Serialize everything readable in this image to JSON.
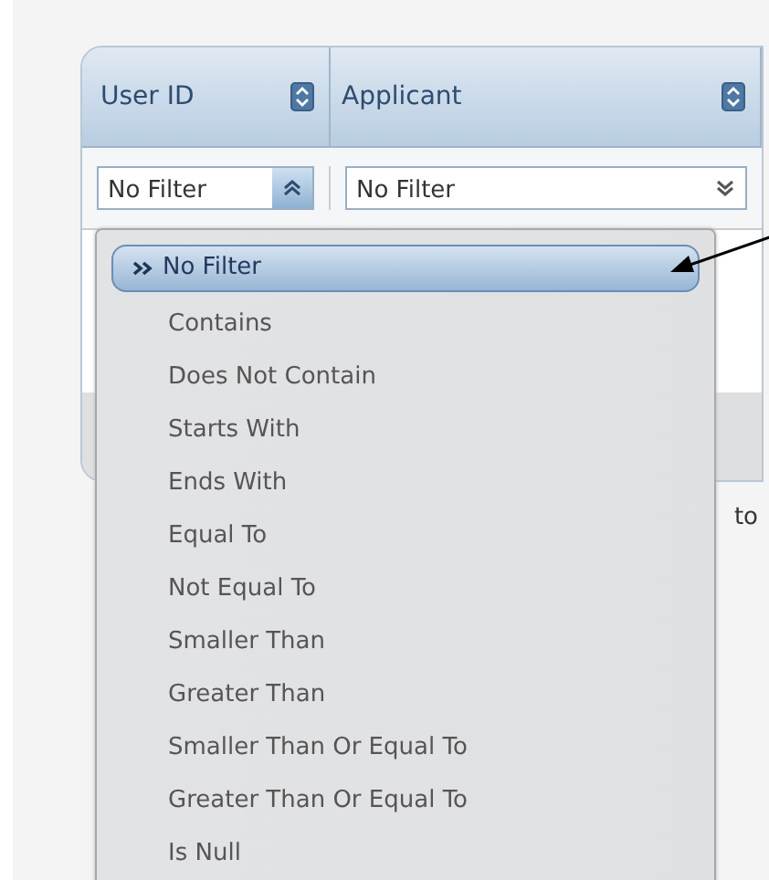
{
  "columns": [
    {
      "title": "User ID",
      "filter": {
        "value": "No Filter",
        "expanded": true
      }
    },
    {
      "title": "Applicant",
      "filter": {
        "value": "No Filter",
        "expanded": false
      }
    }
  ],
  "filter_menu": {
    "items": [
      {
        "label": "No Filter",
        "selected": true
      },
      {
        "label": "Contains",
        "selected": false
      },
      {
        "label": "Does Not Contain",
        "selected": false
      },
      {
        "label": "Starts With",
        "selected": false
      },
      {
        "label": "Ends With",
        "selected": false
      },
      {
        "label": "Equal To",
        "selected": false
      },
      {
        "label": "Not Equal To",
        "selected": false
      },
      {
        "label": "Smaller Than",
        "selected": false
      },
      {
        "label": "Greater Than",
        "selected": false
      },
      {
        "label": "Smaller Than Or Equal To",
        "selected": false
      },
      {
        "label": "Greater Than Or Equal To",
        "selected": false
      },
      {
        "label": "Is Null",
        "selected": false
      }
    ]
  },
  "pager_text": "to"
}
